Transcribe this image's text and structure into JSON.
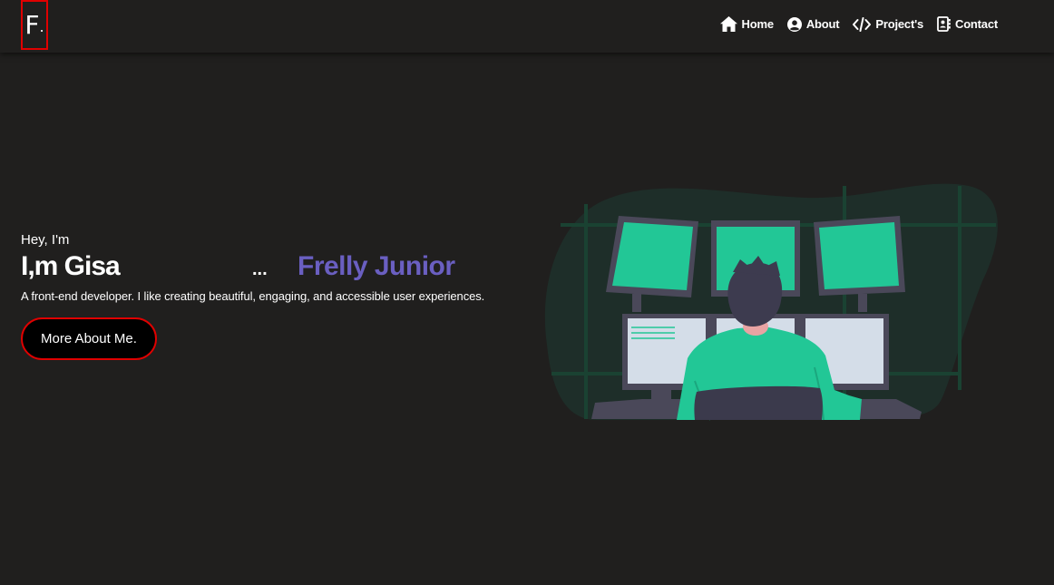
{
  "nav": {
    "logo_letter": "F",
    "logo_dot": ".",
    "links": [
      {
        "label": "Home",
        "icon": "home-icon"
      },
      {
        "label": "About",
        "icon": "user-circle-icon"
      },
      {
        "label": "Project's",
        "icon": "code-icon"
      },
      {
        "label": "Contact",
        "icon": "contact-card-icon"
      }
    ]
  },
  "hero": {
    "greeting": "Hey, I'm",
    "headline_static": "I,m Gisa",
    "headline_dots": "...",
    "headline_typed": "Frelly Junior",
    "tagline": "A front-end developer. I like creating beautiful, engaging, and accessible user experiences.",
    "cta_label": "More About Me."
  },
  "colors": {
    "background": "#201f1e",
    "accent_red": "#e00000",
    "accent_purple": "#6a5fc1",
    "illustration_green": "#22c796"
  }
}
